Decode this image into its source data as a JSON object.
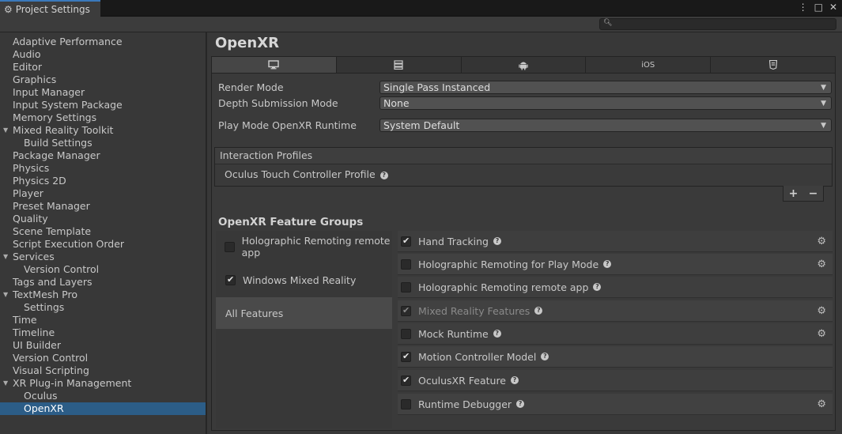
{
  "window": {
    "tab_title": "Project Settings",
    "controls": [
      "⋮",
      "□",
      "✕"
    ]
  },
  "search": {
    "value": "",
    "placeholder": ""
  },
  "sidebar": {
    "items": [
      {
        "label": "Adaptive Performance",
        "child": false
      },
      {
        "label": "Audio",
        "child": false
      },
      {
        "label": "Editor",
        "child": false
      },
      {
        "label": "Graphics",
        "child": false
      },
      {
        "label": "Input Manager",
        "child": false
      },
      {
        "label": "Input System Package",
        "child": false
      },
      {
        "label": "Memory Settings",
        "child": false
      },
      {
        "label": "Mixed Reality Toolkit",
        "child": false,
        "expanded": true
      },
      {
        "label": "Build Settings",
        "child": true
      },
      {
        "label": "Package Manager",
        "child": false
      },
      {
        "label": "Physics",
        "child": false
      },
      {
        "label": "Physics 2D",
        "child": false
      },
      {
        "label": "Player",
        "child": false
      },
      {
        "label": "Preset Manager",
        "child": false
      },
      {
        "label": "Quality",
        "child": false
      },
      {
        "label": "Scene Template",
        "child": false
      },
      {
        "label": "Script Execution Order",
        "child": false
      },
      {
        "label": "Services",
        "child": false,
        "expanded": true
      },
      {
        "label": "Version Control",
        "child": true
      },
      {
        "label": "Tags and Layers",
        "child": false
      },
      {
        "label": "TextMesh Pro",
        "child": false,
        "expanded": true
      },
      {
        "label": "Settings",
        "child": true
      },
      {
        "label": "Time",
        "child": false
      },
      {
        "label": "Timeline",
        "child": false
      },
      {
        "label": "UI Builder",
        "child": false
      },
      {
        "label": "Version Control",
        "child": false
      },
      {
        "label": "Visual Scripting",
        "child": false
      },
      {
        "label": "XR Plug-in Management",
        "child": false,
        "expanded": true
      },
      {
        "label": "Oculus",
        "child": true
      },
      {
        "label": "OpenXR",
        "child": true,
        "selected": true
      }
    ]
  },
  "main": {
    "title": "OpenXR",
    "platform_tabs": [
      {
        "icon": "desktop-icon",
        "label": "",
        "active": true
      },
      {
        "icon": "server-icon",
        "label": ""
      },
      {
        "icon": "android-icon",
        "label": ""
      },
      {
        "icon": "ios-icon",
        "label": "iOS"
      },
      {
        "icon": "html5-icon",
        "label": ""
      }
    ],
    "render_mode": {
      "label": "Render Mode",
      "value": "Single Pass Instanced"
    },
    "depth_submission": {
      "label": "Depth Submission Mode",
      "value": "None"
    },
    "play_mode_runtime": {
      "label": "Play Mode OpenXR Runtime",
      "value": "System Default"
    },
    "interaction_profiles": {
      "header": "Interaction Profiles",
      "items": [
        "Oculus Touch Controller Profile"
      ],
      "add": "+",
      "remove": "−"
    },
    "feature_groups_title": "OpenXR Feature Groups",
    "feature_groups": [
      {
        "label": "Holographic Remoting remote app",
        "checked": false,
        "has_checkbox": true
      },
      {
        "label": "Windows Mixed Reality",
        "checked": true,
        "has_checkbox": true
      },
      {
        "label": "All Features",
        "has_checkbox": false,
        "selected": true
      }
    ],
    "features": [
      {
        "label": "Hand Tracking",
        "checked": true,
        "gear": true
      },
      {
        "label": "Holographic Remoting for Play Mode",
        "checked": false,
        "gear": true
      },
      {
        "label": "Holographic Remoting remote app",
        "checked": false,
        "gear": false
      },
      {
        "label": "Mixed Reality Features",
        "checked": true,
        "gear": true,
        "disabled": true
      },
      {
        "label": "Mock Runtime",
        "checked": false,
        "gear": true
      },
      {
        "label": "Motion Controller Model",
        "checked": true,
        "gear": false
      },
      {
        "label": "OculusXR Feature",
        "checked": true,
        "gear": false
      },
      {
        "label": "Runtime Debugger",
        "checked": false,
        "gear": true
      }
    ]
  },
  "colors": {
    "selection": "#2c5d87",
    "panel_bg": "#383838",
    "accent_tab": "#3a79bb"
  }
}
